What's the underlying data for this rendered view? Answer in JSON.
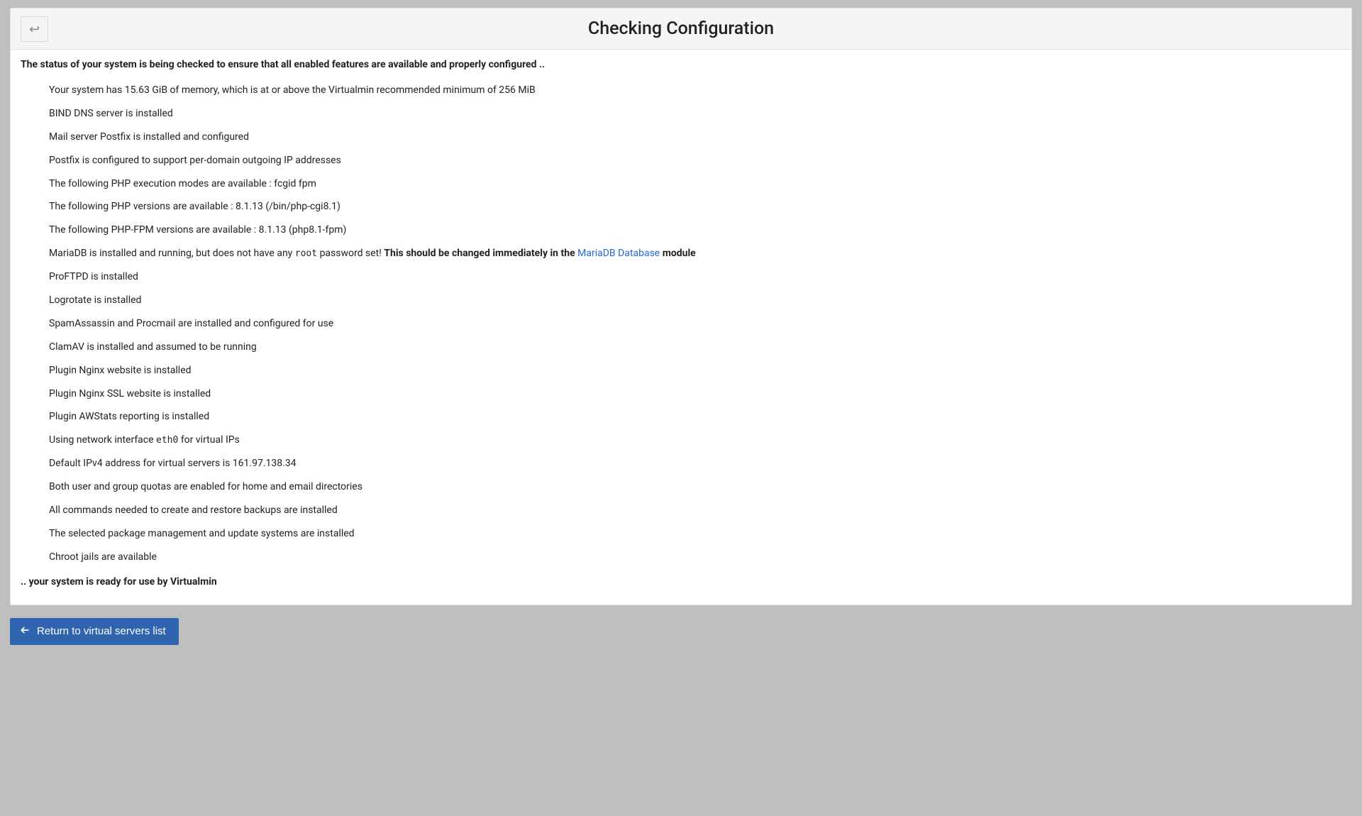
{
  "header": {
    "title": "Checking Configuration"
  },
  "intro": "The status of your system is being checked to ensure that all enabled features are available and properly configured ..",
  "checks": {
    "memory": "Your system has 15.63 GiB of memory, which is at or above the Virtualmin recommended minimum of 256 MiB",
    "bind": "BIND DNS server is installed",
    "postfix": "Mail server Postfix is installed and configured",
    "postfix_ip": "Postfix is configured to support per-domain outgoing IP addresses",
    "php_modes": "The following PHP execution modes are available : fcgid fpm",
    "php_versions": "The following PHP versions are available : 8.1.13 (/bin/php-cgi8.1)",
    "php_fpm": "The following PHP-FPM versions are available : 8.1.13 (php8.1-fpm)",
    "mariadb_pre": "MariaDB is installed and running, but does not have any ",
    "mariadb_code": "root",
    "mariadb_post": " password set! ",
    "mariadb_bold_pre": "This should be changed immediately in the ",
    "mariadb_link": "MariaDB Database",
    "mariadb_bold_post": " module",
    "proftpd": "ProFTPD is installed",
    "logrotate": "Logrotate is installed",
    "spam": "SpamAssassin and Procmail are installed and configured for use",
    "clamav": "ClamAV is installed and assumed to be running",
    "nginx": "Plugin Nginx website is installed",
    "nginx_ssl": "Plugin Nginx SSL website is installed",
    "awstats": "Plugin AWStats reporting is installed",
    "iface_pre": "Using network interface ",
    "iface_code": "eth0",
    "iface_post": " for virtual IPs",
    "ipv4": "Default IPv4 address for virtual servers is 161.97.138.34",
    "quotas": "Both user and group quotas are enabled for home and email directories",
    "backups": "All commands needed to create and restore backups are installed",
    "packages": "The selected package management and update systems are installed",
    "chroot": "Chroot jails are available"
  },
  "outro": ".. your system is ready for use by Virtualmin",
  "footer": {
    "return_label": "Return to virtual servers list"
  }
}
